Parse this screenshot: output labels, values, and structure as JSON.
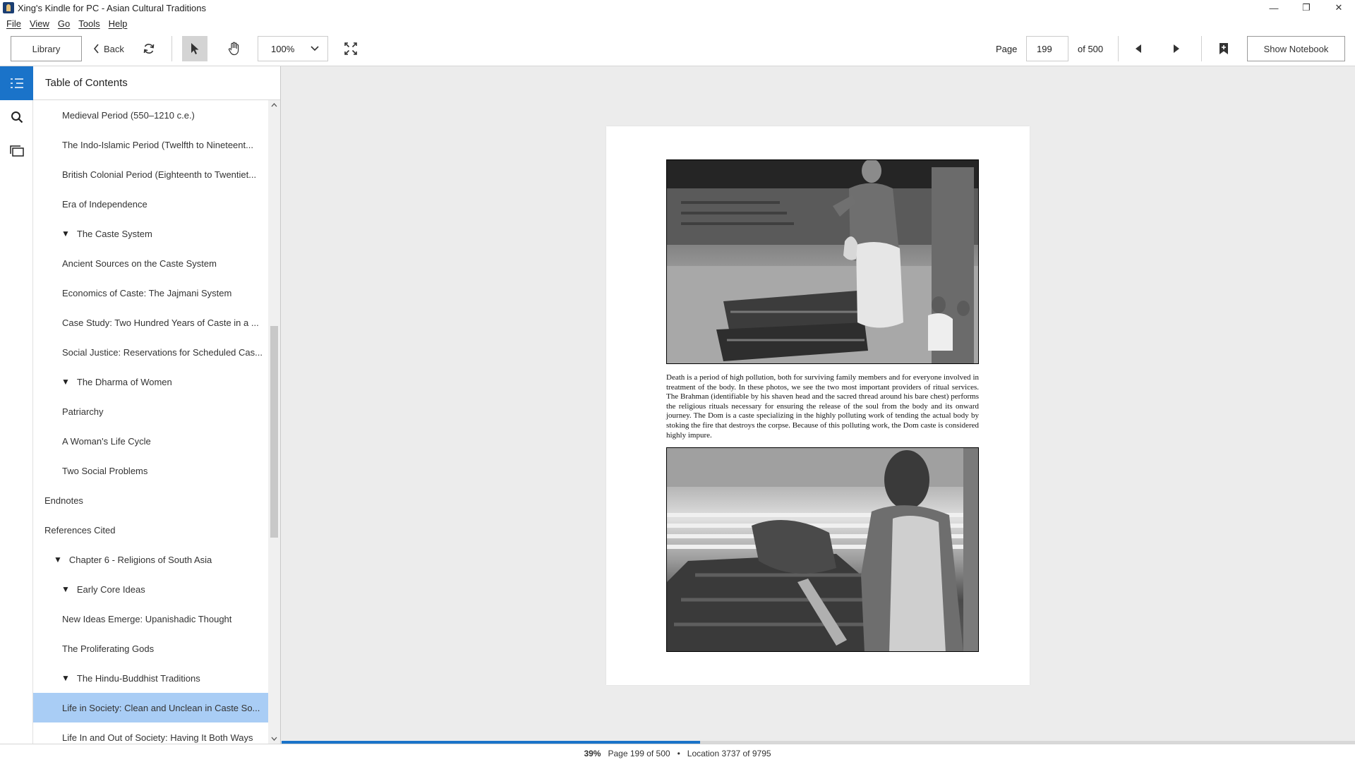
{
  "window": {
    "title": "Xing's Kindle for PC - Asian Cultural Traditions",
    "minimize": "—",
    "restore": "❐",
    "close": "✕"
  },
  "menu": [
    "File",
    "View",
    "Go",
    "Tools",
    "Help"
  ],
  "toolbar": {
    "library_label": "Library",
    "back_label": "Back",
    "zoom_value": "100%",
    "page_label": "Page",
    "page_value": "199",
    "of_label": "of 500",
    "notebook_label": "Show Notebook"
  },
  "toc": {
    "title": "Table of Contents",
    "items": [
      {
        "label": "Medieval Period (550–1210 c.e.)",
        "level": 3
      },
      {
        "label": "The Indo-Islamic Period (Twelfth to Nineteent...",
        "level": 3
      },
      {
        "label": "British Colonial Period (Eighteenth to Twentiet...",
        "level": 3
      },
      {
        "label": "Era of Independence",
        "level": 3
      },
      {
        "label": "The Caste System",
        "level": 2,
        "expanded": true
      },
      {
        "label": "Ancient Sources on the Caste System",
        "level": 3
      },
      {
        "label": "Economics of Caste: The Jajmani System",
        "level": 3
      },
      {
        "label": "Case Study: Two Hundred Years of Caste in a ...",
        "level": 3
      },
      {
        "label": "Social Justice: Reservations for Scheduled Cas...",
        "level": 3
      },
      {
        "label": "The Dharma of Women",
        "level": 2,
        "expanded": true
      },
      {
        "label": "Patriarchy",
        "level": 3
      },
      {
        "label": "A Woman's Life Cycle",
        "level": 3
      },
      {
        "label": "Two Social Problems",
        "level": 3
      },
      {
        "label": "Endnotes",
        "level": 0
      },
      {
        "label": "References Cited",
        "level": 0
      },
      {
        "label": "Chapter 6 - Religions of South Asia",
        "level": 1,
        "expanded": true
      },
      {
        "label": "Early Core Ideas",
        "level": 2,
        "expanded": true
      },
      {
        "label": "New Ideas Emerge: Upanishadic Thought",
        "level": 3
      },
      {
        "label": "The Proliferating Gods",
        "level": 3
      },
      {
        "label": "The Hindu-Buddhist Traditions",
        "level": 2,
        "expanded": true
      },
      {
        "label": "Life in Society: Clean and Unclean in Caste So...",
        "level": 3,
        "selected": true
      },
      {
        "label": "Life In and Out of Society: Having It Both Ways",
        "level": 3
      }
    ]
  },
  "page": {
    "caption": "Death is a period of high pollution, both for surviving family members and for everyone involved in treatment of the body. In these photos, we see the two most important providers of ritual services. The Brahman (identifiable by his shaven head and the sacred thread around his bare chest) performs the religious rituals necessary for ensuring the release of the soul from the body and its onward journey. The Dom is a caste specializing in the highly polluting work of tending the actual body by stoking the fire that destroys the corpse. Because of this polluting work, the Dom caste is considered highly impure."
  },
  "status": {
    "percent": "39%",
    "page_text": "Page 199 of 500",
    "separator": "•",
    "location_text": "Location 3737 of 9795",
    "progress_fraction": 0.39
  },
  "colors": {
    "accent": "#1a73c9",
    "selected_row": "#a9cdf5"
  }
}
